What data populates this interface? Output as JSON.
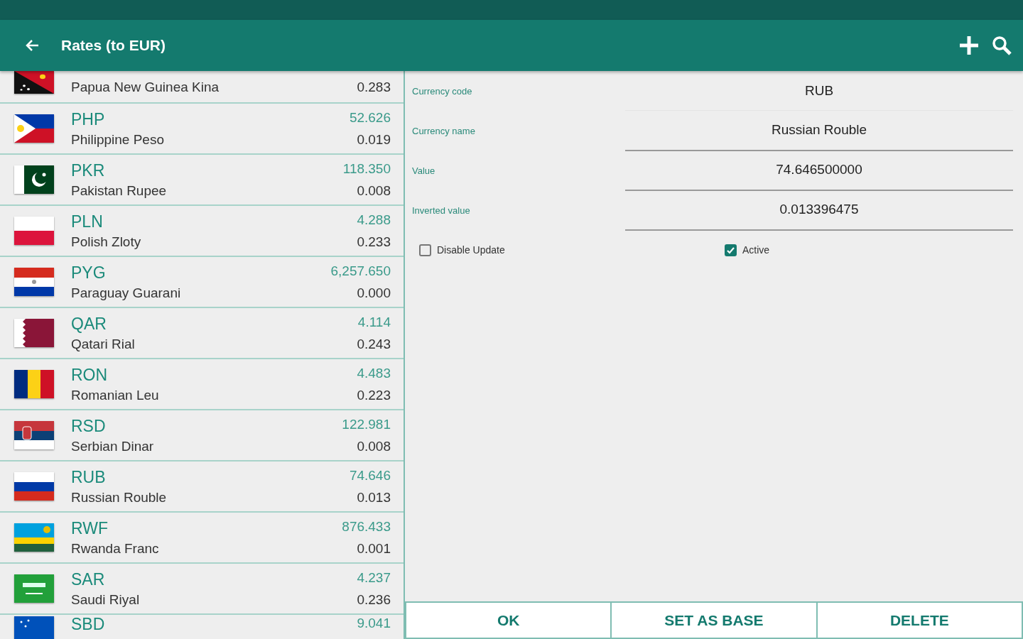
{
  "toolbar": {
    "title": "Rates (to EUR)"
  },
  "currencies": [
    {
      "kind": "partial",
      "name": "Papua New Guinea Kina",
      "inverted": "0.283"
    },
    {
      "kind": "full",
      "code": "PHP",
      "name": "Philippine Peso",
      "rate": "52.626",
      "inverted": "0.019"
    },
    {
      "kind": "full",
      "code": "PKR",
      "name": "Pakistan Rupee",
      "rate": "118.350",
      "inverted": "0.008"
    },
    {
      "kind": "full",
      "code": "PLN",
      "name": "Polish Zloty",
      "rate": "4.288",
      "inverted": "0.233"
    },
    {
      "kind": "full",
      "code": "PYG",
      "name": "Paraguay Guarani",
      "rate": "6,257.650",
      "inverted": "0.000"
    },
    {
      "kind": "full",
      "code": "QAR",
      "name": "Qatari Rial",
      "rate": "4.114",
      "inverted": "0.243"
    },
    {
      "kind": "full",
      "code": "RON",
      "name": "Romanian Leu",
      "rate": "4.483",
      "inverted": "0.223"
    },
    {
      "kind": "full",
      "code": "RSD",
      "name": "Serbian Dinar",
      "rate": "122.981",
      "inverted": "0.008"
    },
    {
      "kind": "full",
      "code": "RUB",
      "name": "Russian Rouble",
      "rate": "74.646",
      "inverted": "0.013"
    },
    {
      "kind": "full",
      "code": "RWF",
      "name": "Rwanda Franc",
      "rate": "876.433",
      "inverted": "0.001"
    },
    {
      "kind": "full",
      "code": "SAR",
      "name": "Saudi Riyal",
      "rate": "4.237",
      "inverted": "0.236"
    },
    {
      "kind": "top",
      "code": "SBD",
      "rate": "9.041"
    }
  ],
  "details": {
    "fields": [
      {
        "label": "Currency code",
        "value": "RUB",
        "underline": false
      },
      {
        "label": "Currency name",
        "value": "Russian Rouble",
        "underline": true
      },
      {
        "label": "Value",
        "value": "74.646500000",
        "underline": true
      },
      {
        "label": "Inverted value",
        "value": "0.013396475",
        "underline": true
      }
    ],
    "checkboxes": [
      {
        "label": "Disable Update",
        "checked": false
      },
      {
        "label": "Active",
        "checked": true
      }
    ],
    "buttons": [
      "OK",
      "SET AS BASE",
      "DELETE"
    ]
  }
}
